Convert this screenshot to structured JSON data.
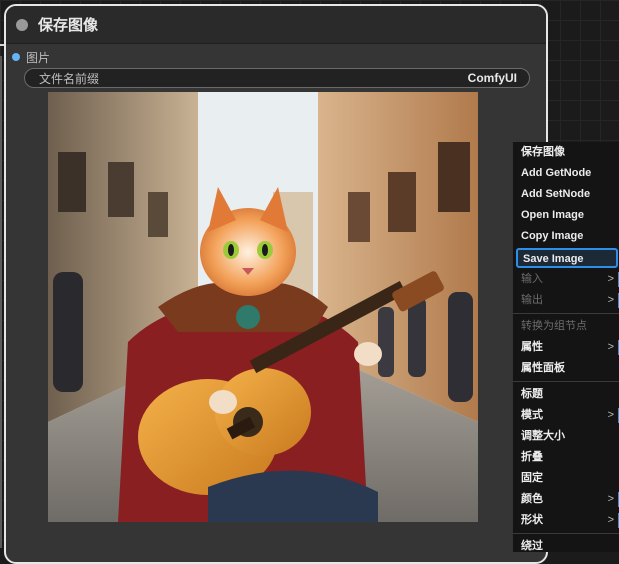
{
  "node": {
    "title": "保存图像",
    "input_label": "图片",
    "widget": {
      "label": "文件名前缀",
      "value": "ComfyUI"
    }
  },
  "menu": {
    "title": "保存图像",
    "items": [
      {
        "label": "Add GetNode",
        "disabled": false,
        "submenu": false
      },
      {
        "label": "Add SetNode",
        "disabled": false,
        "submenu": false
      },
      {
        "label": "Open Image",
        "disabled": false,
        "submenu": false
      },
      {
        "label": "Copy Image",
        "disabled": false,
        "submenu": false
      },
      {
        "label": "Save Image",
        "disabled": false,
        "submenu": false,
        "highlighted": true
      },
      {
        "label": "输入",
        "disabled": true,
        "submenu": true
      },
      {
        "label": "输出",
        "disabled": true,
        "submenu": true
      },
      {
        "label": "转换为组节点",
        "disabled": true,
        "submenu": false
      },
      {
        "label": "属性",
        "disabled": false,
        "submenu": true
      },
      {
        "label": "属性面板",
        "disabled": false,
        "submenu": false
      },
      {
        "label": "标题",
        "disabled": false,
        "submenu": false
      },
      {
        "label": "模式",
        "disabled": false,
        "submenu": true
      },
      {
        "label": "调整大小",
        "disabled": false,
        "submenu": false
      },
      {
        "label": "折叠",
        "disabled": false,
        "submenu": false
      },
      {
        "label": "固定",
        "disabled": false,
        "submenu": false
      },
      {
        "label": "颜色",
        "disabled": false,
        "submenu": true
      },
      {
        "label": "形状",
        "disabled": false,
        "submenu": true
      },
      {
        "label": "绕过",
        "disabled": false,
        "submenu": false
      }
    ],
    "arrow_glyph": ">"
  },
  "colors": {
    "accent": "#2e8ee8",
    "input_dot": "#64b5f6"
  }
}
